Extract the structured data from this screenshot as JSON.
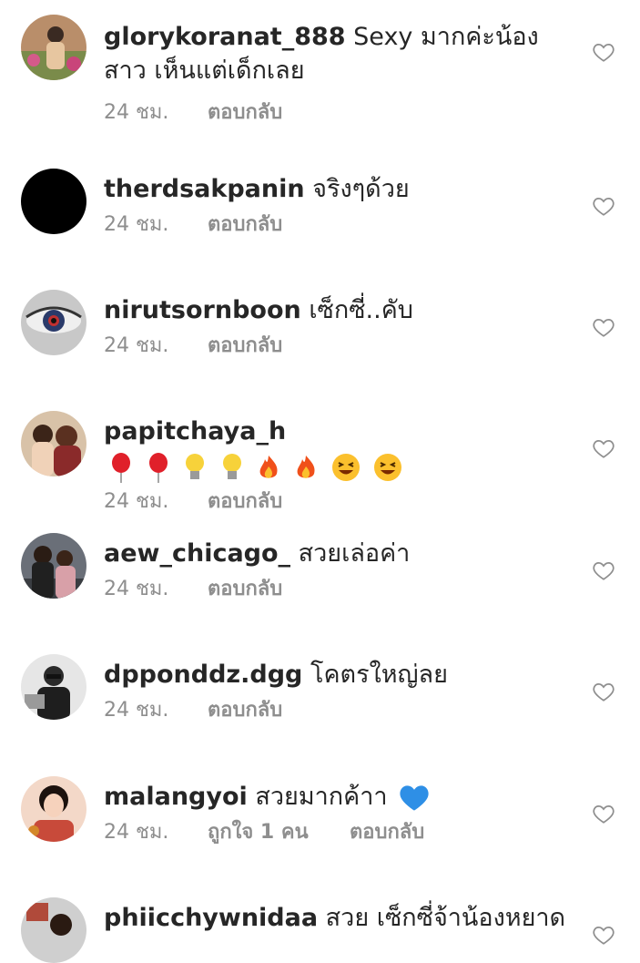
{
  "comments": [
    {
      "username": "glorykoranat_888",
      "text": "Sexy มากค่ะน้องสาว เห็นแต่เด็กเลย",
      "time": "24 ชม.",
      "reply": "ตอบกลับ",
      "likes": ""
    },
    {
      "username": "therdsakpanin",
      "text": "จริงๆด้วย",
      "time": "24 ชม.",
      "reply": "ตอบกลับ",
      "likes": ""
    },
    {
      "username": "nirutsornboon",
      "text": "เซ็กซี่..คับ",
      "time": "24 ชม.",
      "reply": "ตอบกลับ",
      "likes": ""
    },
    {
      "username": "papitchaya_h",
      "text": "",
      "emojis": [
        "balloon-emoji",
        "balloon-emoji",
        "light-bulb-emoji",
        "light-bulb-emoji",
        "fire-emoji",
        "fire-emoji",
        "grinning-squint-emoji",
        "grinning-squint-emoji"
      ],
      "time": "24 ชม.",
      "reply": "ตอบกลับ",
      "likes": ""
    },
    {
      "username": "aew_chicago_",
      "text": "สวยเล่อค่า",
      "time": "24 ชม.",
      "reply": "ตอบกลับ",
      "likes": ""
    },
    {
      "username": "dpponddz.dgg",
      "text": "โคตรใหญ่ลย",
      "time": "24 ชม.",
      "reply": "ตอบกลับ",
      "likes": ""
    },
    {
      "username": "malangyoi",
      "text": "สวยมากค้าา",
      "emojis": [
        "blue-heart-emoji"
      ],
      "time": "24 ชม.",
      "reply": "ตอบกลับ",
      "likes": "ถูกใจ 1 คน"
    },
    {
      "username": "phiicchywnidaa",
      "text": "สวย เซ็กซี่จ้าน้องหยาด",
      "time": "",
      "reply": "",
      "likes": ""
    }
  ],
  "colors": {
    "text": "#262626",
    "meta": "#8e8e8e",
    "heart_outline": "#8e8e8e"
  }
}
